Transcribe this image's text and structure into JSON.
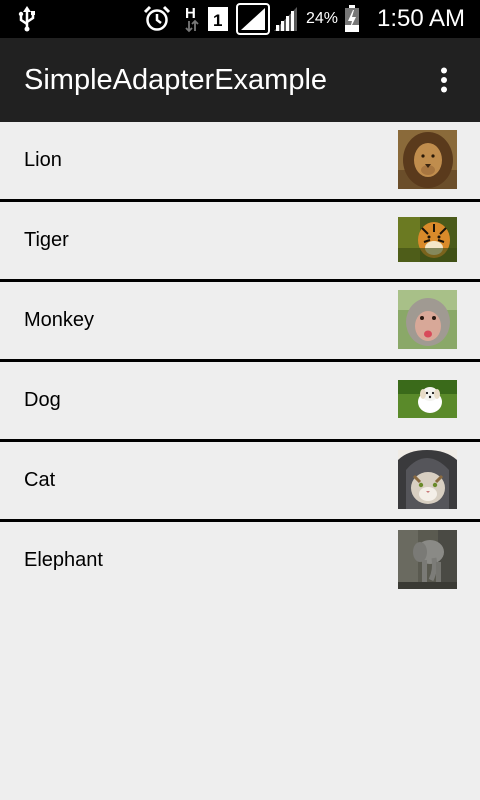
{
  "status_bar": {
    "battery_percent": "24%",
    "clock": "1:50 AM",
    "icons": [
      "usb-icon",
      "alarm-icon",
      "h-data-icon",
      "sim-1-icon",
      "signal-1-icon",
      "signal-2-icon",
      "battery-charging-icon"
    ]
  },
  "app_bar": {
    "title": "SimpleAdapterExample",
    "overflow_icon": "overflow-menu-icon"
  },
  "list": {
    "items": [
      {
        "label": "Lion",
        "image": "lion-image"
      },
      {
        "label": "Tiger",
        "image": "tiger-image"
      },
      {
        "label": "Monkey",
        "image": "monkey-image"
      },
      {
        "label": "Dog",
        "image": "dog-image"
      },
      {
        "label": "Cat",
        "image": "cat-image"
      },
      {
        "label": "Elephant",
        "image": "elephant-image"
      }
    ]
  },
  "colors": {
    "status_bar_bg": "#000000",
    "app_bar_bg": "#212121",
    "list_bg": "#eeeeee",
    "divider": "#000000"
  }
}
